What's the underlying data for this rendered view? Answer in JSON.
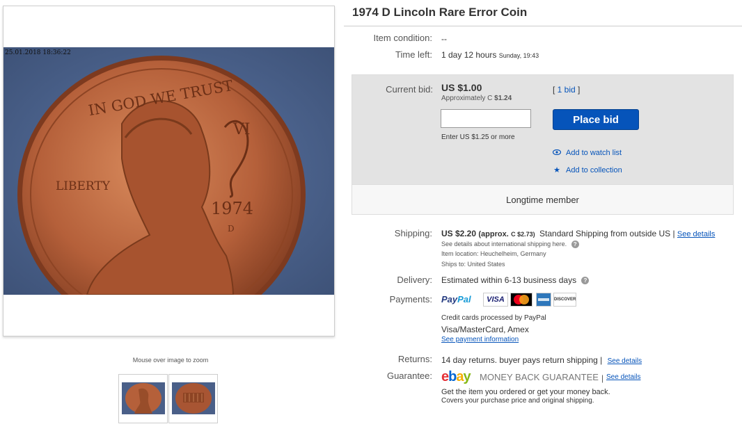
{
  "listing": {
    "title": "1974 D Lincoln Rare Error Coin",
    "photo_timestamp": "25.01.2018 18:36:22",
    "zoom_hint": "Mouse over image to zoom"
  },
  "details": {
    "condition_label": "Item condition:",
    "condition_value": "--",
    "time_left_label": "Time left:",
    "time_left_value": "1 day 12 hours",
    "time_left_end": "Sunday, 19:43"
  },
  "bid": {
    "current_bid_label": "Current bid:",
    "current_bid_value": "US $1.00",
    "approx_label": "Approximately C",
    "approx_value": "$1.24",
    "bid_count": "1 bid",
    "bid_hint": "Enter US $1.25 or more",
    "place_bid_label": "Place bid",
    "watch_label": "Add to watch list",
    "collection_label": "Add to collection",
    "member_label": "Longtime member"
  },
  "shipping": {
    "label": "Shipping:",
    "price": "US $2.20",
    "approx": "(approx.",
    "approx_value": "C $2.73)",
    "method": "Standard Shipping from outside US |",
    "see_details": "See details",
    "intl_note": "See details about international shipping here.",
    "location": "Item location:  Heuchelheim, Germany",
    "ships_to": "Ships to:  United States"
  },
  "delivery": {
    "label": "Delivery:",
    "value": "Estimated within 6-13 business days"
  },
  "payments": {
    "label": "Payments:",
    "paypal_a": "Pay",
    "paypal_b": "Pal",
    "visa": "VISA",
    "discover": "DISCOVER",
    "credit_note": "Credit cards processed by PayPal",
    "cards": "Visa/MasterCard, Amex",
    "see_info": "See payment information"
  },
  "returns": {
    "label": "Returns:",
    "value": "14 day returns. buyer pays return shipping |",
    "see_details": "See details"
  },
  "guarantee": {
    "label": "Guarantee:",
    "mbg": "MONEY BACK GUARANTEE",
    "sep": "|",
    "see_details": "See details",
    "line1": "Get the item you ordered or get your money back.",
    "line2": "Covers your purchase price and original shipping."
  },
  "coin": {
    "motto": "IN GOD WE TRUST",
    "liberty": "LIBERTY",
    "year": "1974",
    "mint": "D"
  },
  "colors": {
    "link": "#0654ba",
    "button": "#0654ba",
    "coin_copper": "#b5603a",
    "background_blue": "#4a5f88"
  }
}
